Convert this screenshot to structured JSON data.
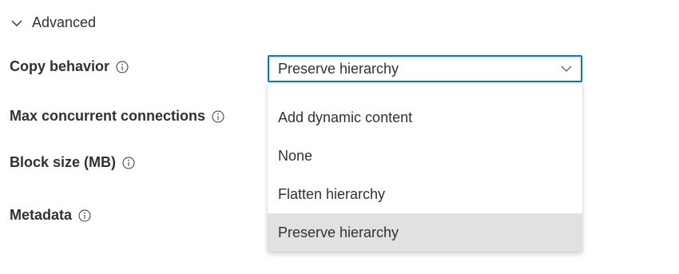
{
  "section": {
    "title": "Advanced",
    "icon": "chevron-down-icon"
  },
  "fields": {
    "copy_behavior": {
      "label": "Copy behavior"
    },
    "max_concurrent": {
      "label": "Max concurrent connections"
    },
    "block_size": {
      "label": "Block size (MB)"
    },
    "metadata": {
      "label": "Metadata"
    }
  },
  "copy_behavior_select": {
    "value": "Preserve hierarchy",
    "icon": "chevron-down-icon",
    "accent_color": "#0078d4"
  },
  "dropdown": {
    "options": [
      {
        "label": "Add dynamic content",
        "selected": false
      },
      {
        "label": "None",
        "selected": false
      },
      {
        "label": "Flatten hierarchy",
        "selected": false
      },
      {
        "label": "Preserve hierarchy",
        "selected": true
      }
    ],
    "selected_bg": "#e1e1e1"
  }
}
